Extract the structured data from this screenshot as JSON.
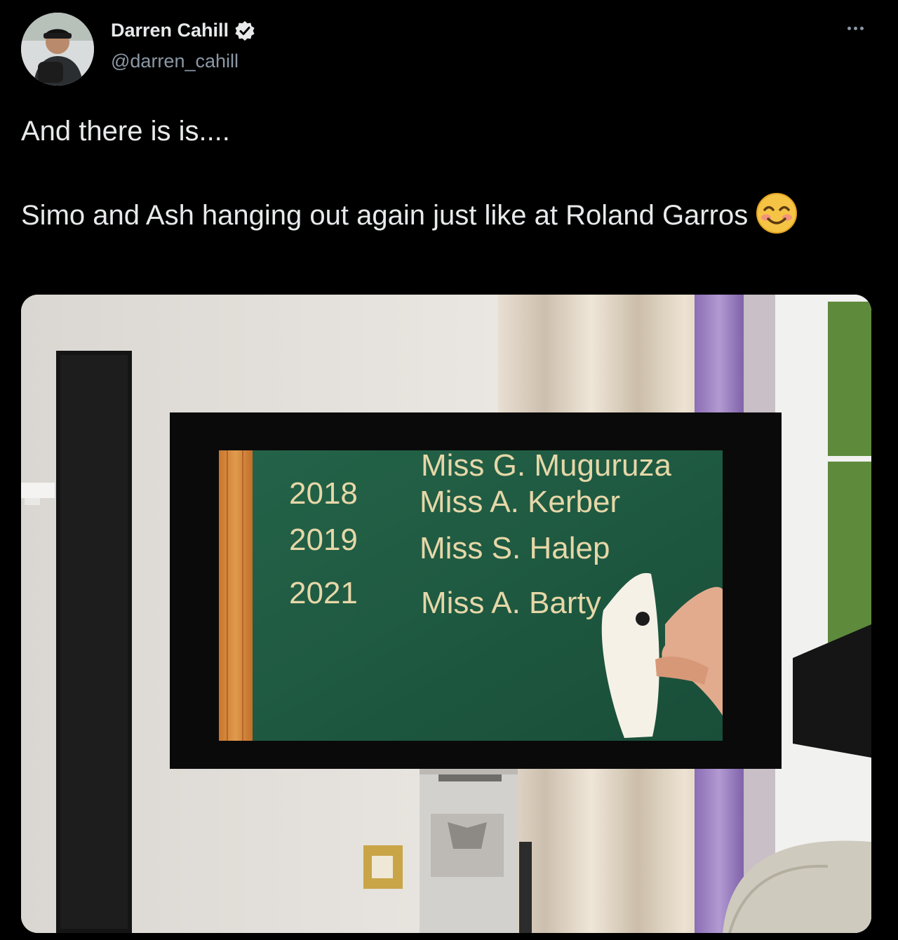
{
  "tweet": {
    "author_name": "Darren Cahill",
    "author_handle": "@darren_cahill",
    "body": "And there is is....\n\nSimo and Ash hanging out again just like at Roland Garros"
  },
  "icons": {
    "verified": "verified-badge-icon",
    "more": "more-options-icon",
    "emoji": "smiling-face-with-smiling-eyes-emoji"
  },
  "colors": {
    "background": "#000000",
    "text": "#e7e9ea",
    "secondary_text": "#8b98a5",
    "verified_badge": "#e7e9ea",
    "board_green": "#1f5a43",
    "board_gold": "#e6d7a8"
  },
  "photo": {
    "board_partial": "Miss G. Muguruza",
    "board_rows": [
      {
        "year": "2018",
        "name": "Miss A. Kerber"
      },
      {
        "year": "2019",
        "name": "Miss S. Halep"
      },
      {
        "year": "2021",
        "name": "Miss A. Barty"
      }
    ]
  }
}
